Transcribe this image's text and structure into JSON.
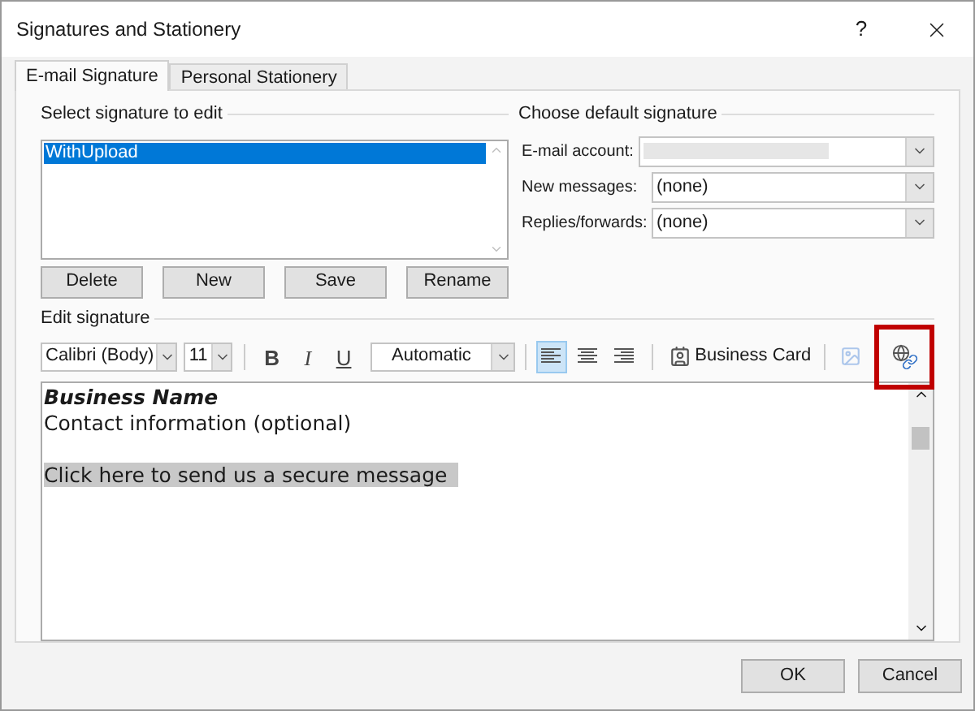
{
  "window": {
    "title": "Signatures and Stationery",
    "help": "?"
  },
  "tabs": [
    {
      "label": "E-mail Signature",
      "selected": true
    },
    {
      "label": "Personal Stationery",
      "selected": false
    }
  ],
  "select_signature": {
    "label": "Select signature to edit",
    "items": [
      {
        "label": "WithUpload",
        "selected": true
      }
    ],
    "buttons": [
      "Delete",
      "New",
      "Save",
      "Rename"
    ]
  },
  "default_signature": {
    "label": "Choose default signature",
    "fields": [
      {
        "label": "E-mail account:",
        "kind": "redacted"
      },
      {
        "label": "New messages:",
        "kind": "text",
        "value": "(none)"
      },
      {
        "label": "Replies/forwards:",
        "kind": "text",
        "value": "(none)"
      }
    ]
  },
  "edit_signature": {
    "label": "Edit signature",
    "toolbar": {
      "font": "Calibri (Body)",
      "size": "11",
      "format_buttons": [
        "B",
        "I",
        "U"
      ],
      "font_color_label": "Automatic",
      "align": [
        {
          "kind": "left",
          "selected": true
        },
        {
          "kind": "center",
          "selected": false
        },
        {
          "kind": "right",
          "selected": false
        }
      ],
      "business_card": "Business Card",
      "picture": {
        "disabled": true
      },
      "hyperlink": {
        "highlighted": true
      }
    },
    "body": [
      {
        "text": "Business Name",
        "kind": "bold-italic"
      },
      {
        "text": "Contact information (optional)",
        "kind": "plain"
      },
      {
        "text": "Click here to send us a secure message",
        "kind": "highlighted"
      }
    ]
  },
  "footer": {
    "buttons": [
      "OK",
      "Cancel"
    ]
  }
}
